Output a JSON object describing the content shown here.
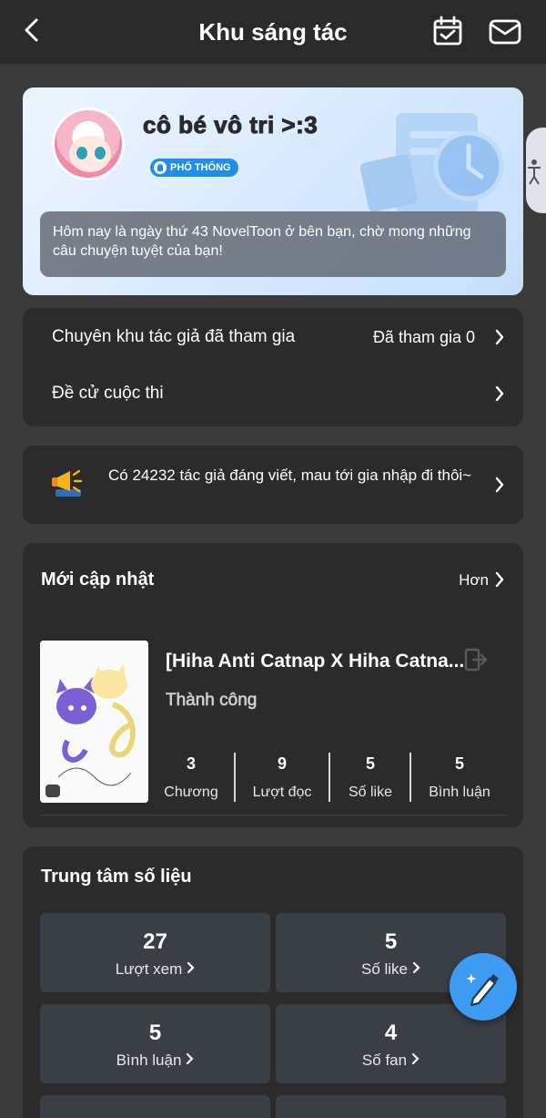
{
  "header": {
    "title": "Khu sáng tác",
    "back_icon": "chevron-left-icon",
    "calendar_icon": "calendar-check-icon",
    "mail_icon": "mail-icon"
  },
  "profile": {
    "username": "cô bé vô tri >:3",
    "badge": "PHỔ THÔNG",
    "welcome": "Hôm nay là ngày thứ 43 NovelToon ở bên bạn, chờ mong những câu chuyện tuyệt của bạn!"
  },
  "links": {
    "joined_zone_label": "Chuyên khu tác giả đã tham gia",
    "joined_zone_value": "Đã tham gia 0",
    "contest_label": "Đề cử cuộc thi"
  },
  "announcement": {
    "text": "Có 24232 tác giả đáng viết, mau tới gia nhập đi thôi~"
  },
  "recent": {
    "title": "Mới cập nhật",
    "more": "Hơn",
    "story": {
      "title": "[Hiha Anti Catnap X Hiha Catna...",
      "status": "Thành công",
      "stats": [
        {
          "value": "3",
          "label": "Chương"
        },
        {
          "value": "9",
          "label": "Lượt đọc"
        },
        {
          "value": "5",
          "label": "Số like"
        },
        {
          "value": "5",
          "label": "Bình luận"
        }
      ]
    }
  },
  "data_center": {
    "title": "Trung tâm số liệu",
    "tiles": [
      {
        "value": "27",
        "label": "Lượt xem"
      },
      {
        "value": "5",
        "label": "Số like"
      },
      {
        "value": "5",
        "label": "Bình luận"
      },
      {
        "value": "4",
        "label": "Số fan"
      }
    ]
  },
  "colors": {
    "accent": "#3d9cf2",
    "badge": "#1f8fe8",
    "card_bg": "#2b2b2b",
    "page_bg": "#3a3a3a"
  }
}
